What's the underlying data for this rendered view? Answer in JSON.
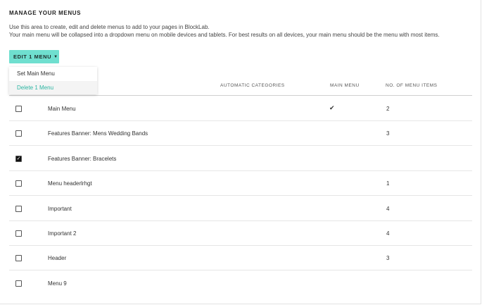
{
  "header": {
    "title": "MANAGE YOUR MENUS",
    "description_line1": "Use this area to create, edit and delete menus to add to your pages in BlockLab.",
    "description_line2": "Your main menu will be collapsed into a dropdown menu on mobile devices and tablets. For best results on all devices, your main menu should be the menu with most items."
  },
  "toolbar": {
    "edit_label": "EDIT 1 MENU",
    "dropdown": [
      {
        "label": "Set Main Menu",
        "active": false
      },
      {
        "label": "Delete 1 Menu",
        "active": true
      }
    ]
  },
  "table": {
    "columns": {
      "categories": "AUTOMATIC CATEGORIES",
      "main": "MAIN MENU",
      "items": "NO. OF MENU ITEMS"
    },
    "rows": [
      {
        "name": "Main Menu",
        "checked": false,
        "main": true,
        "count": "2"
      },
      {
        "name": "Features Banner: Mens Wedding Bands",
        "checked": false,
        "main": false,
        "count": "3"
      },
      {
        "name": "Features Banner: Bracelets",
        "checked": true,
        "main": false,
        "count": ""
      },
      {
        "name": "Menu headerlrhgt",
        "checked": false,
        "main": false,
        "count": "1"
      },
      {
        "name": "Important",
        "checked": false,
        "main": false,
        "count": "4"
      },
      {
        "name": "Important 2",
        "checked": false,
        "main": false,
        "count": "4"
      },
      {
        "name": "Header",
        "checked": false,
        "main": false,
        "count": "3"
      },
      {
        "name": "Menu 9",
        "checked": false,
        "main": false,
        "count": ""
      }
    ]
  },
  "icons": {
    "caret": "caret-down-icon",
    "checkmark": "checkmark-icon"
  },
  "colors": {
    "accent": "#6fdfcf",
    "accent_text": "#2bb5a2"
  }
}
